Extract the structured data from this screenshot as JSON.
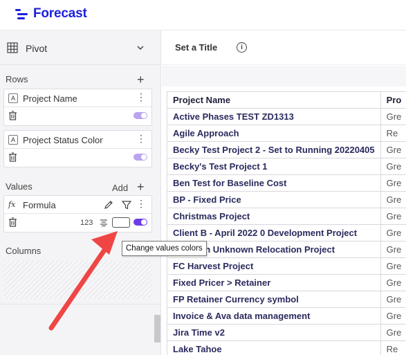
{
  "app": {
    "name": "Forecast"
  },
  "sidebar": {
    "pivot_label": "Pivot",
    "rows_title": "Rows",
    "rows": [
      {
        "type": "A",
        "label": "Project Name"
      },
      {
        "type": "A",
        "label": "Project Status Color"
      }
    ],
    "values_title": "Values",
    "values_add_label": "Add",
    "values": [
      {
        "type": "fx",
        "label": "Formula",
        "format": "123"
      }
    ],
    "columns_title": "Columns"
  },
  "tooltip": {
    "text": "Change values colors"
  },
  "main": {
    "title_label": "Set a Title",
    "info_icon": "i",
    "table": {
      "headers": [
        "Project Name",
        "Pro"
      ],
      "rows": [
        {
          "name": "Active Phases TEST ZD1313",
          "status": "Gre"
        },
        {
          "name": "Agile Approach",
          "status": "Re"
        },
        {
          "name": "Becky Test Project 2 - Set to Running 20220405",
          "status": "Gre"
        },
        {
          "name": "Becky's Test Project 1",
          "status": "Gre"
        },
        {
          "name": "Ben Test for Baseline Cost",
          "status": "Gre"
        },
        {
          "name": "BP - Fixed Price",
          "status": "Gre"
        },
        {
          "name": "Christmas Project",
          "status": "Gre"
        },
        {
          "name": "Client B - April 2022 0 Development Project",
          "status": "Gre"
        },
        {
          "name": "Location Unknown Relocation Project",
          "status": "Gre"
        },
        {
          "name": "FC Harvest Project",
          "status": "Gre"
        },
        {
          "name": "Fixed Pricer > Retainer",
          "status": "Gre"
        },
        {
          "name": "FP Retainer Currency symbol",
          "status": "Gre"
        },
        {
          "name": "Invoice & Ava data management",
          "status": "Gre"
        },
        {
          "name": "Jira Time v2",
          "status": "Gre"
        },
        {
          "name": "Lake Tahoe",
          "status": "Re"
        }
      ]
    }
  },
  "colors": {
    "brand": "#1b1fdc",
    "toggle": "#6c3ce9",
    "arrow": "#f04545"
  }
}
